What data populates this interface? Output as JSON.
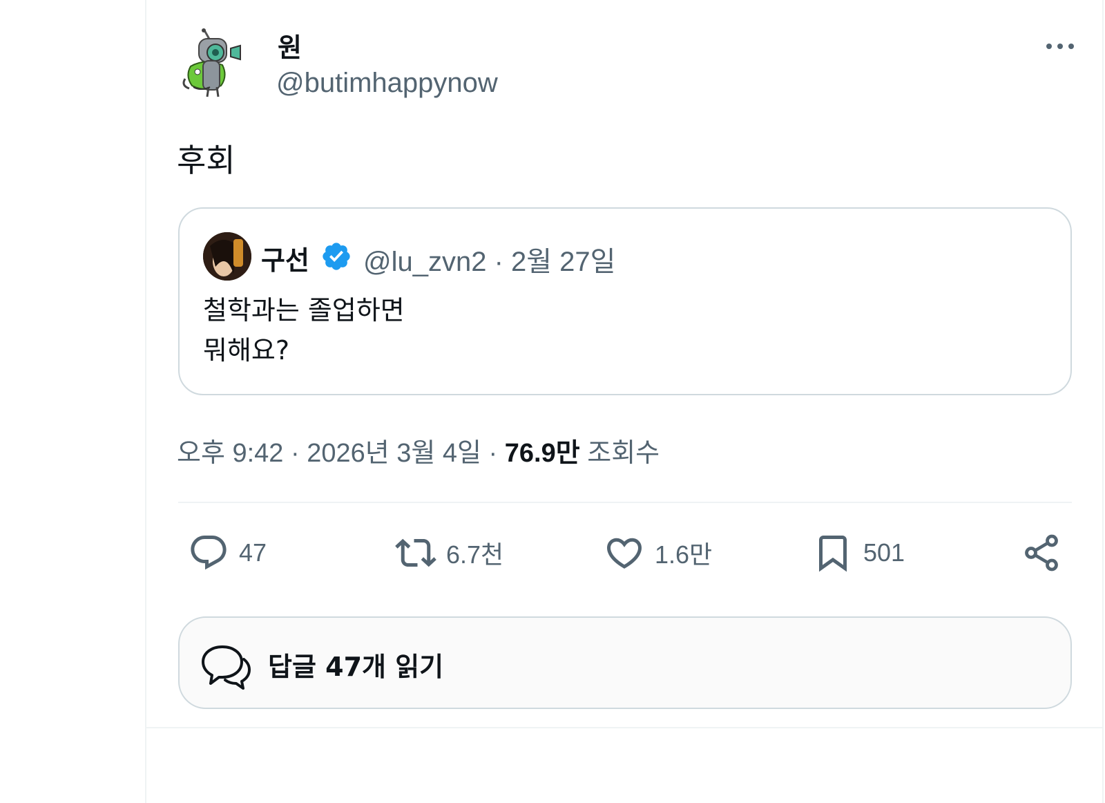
{
  "tweet": {
    "author_name": "원",
    "author_handle": "@butimhappynow",
    "text": "후회",
    "quote": {
      "author_name": "구선",
      "meta": "@lu_zvn2 · 2월 27일",
      "line1": "철학과는 졸업하면",
      "line2": "뭐해요?"
    },
    "timestamp": "오후 9:42 · 2026년 3월 4일 · ",
    "views_count": "76.9만",
    "views_label": " 조회수",
    "reply_count": "47",
    "retweet_count": "6.7천",
    "like_count": "1.6만",
    "bookmark_count": "501",
    "read_replies_label": "답글 47개 읽기"
  },
  "icons": {
    "more": "more-horizontal-icon",
    "verified": "verified-badge-icon",
    "reply": "reply-icon",
    "retweet": "retweet-icon",
    "like": "heart-icon",
    "bookmark": "bookmark-icon",
    "share": "share-icon"
  },
  "colors": {
    "text_primary": "#0f1419",
    "text_secondary": "#536471",
    "border": "#cfd9de",
    "verified_blue": "#1d9bf0"
  }
}
